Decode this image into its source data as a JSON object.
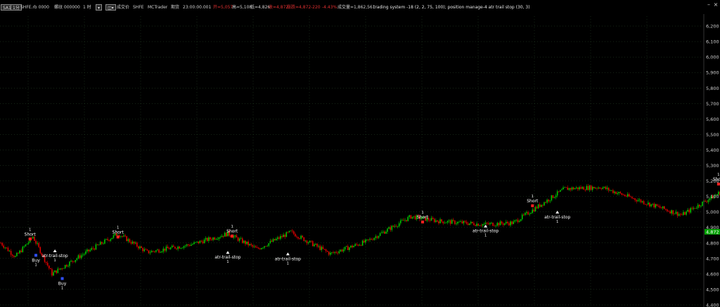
{
  "header": {
    "symbol_button": "SA1",
    "interval_button": "1分",
    "symbol": "SHFE.rb 0000",
    "name": "螺纹 000000",
    "period": "1 时",
    "menu_button_1": "▾",
    "menu_button_2": "◫▾",
    "volume_label": "成交价",
    "exchange": "SHFE",
    "source": "MCTrader",
    "range_label": "期货",
    "time": "23:00:00.001",
    "open": "开=5,057",
    "high": "高=5,108",
    "low": "低=4,826",
    "close": "收=4,872",
    "change": "涨跌=4,872",
    "delta": "-220",
    "pct": "-4.43%",
    "turnover": "成交量=1,862,561",
    "strategy": "trading system -18 (2, 2, 75, 100); position manage-4 atr trail stop (30, 3)",
    "price_tag": "4,872",
    "colors": {
      "up": "#00c800",
      "down": "#e00000",
      "grid": "#2b4a2b",
      "axis_text": "#cfcfcf",
      "tag_bg": "#00a000"
    }
  },
  "chart_data": {
    "type": "candlestick",
    "y_axis_side": "right",
    "ylim": [
      4400,
      6300
    ],
    "yticks": [
      4400,
      4500,
      4600,
      4700,
      4800,
      4900,
      5000,
      5100,
      5200,
      5300,
      5400,
      5500,
      5600,
      5700,
      5800,
      5900,
      6000,
      6100,
      6200
    ],
    "ytick_labels": [
      "4,400",
      "4,500",
      "4,600",
      "4,700",
      "4,800",
      "4,900",
      "5,000",
      "5,100",
      "5,200",
      "5,300",
      "5,400",
      "5,500",
      "5,600",
      "5,700",
      "5,800",
      "5,900",
      "6,000",
      "6,100",
      "6,200"
    ],
    "grid": true,
    "bar_count": 480,
    "path": [
      [
        0,
        4800
      ],
      [
        10,
        4710
      ],
      [
        22,
        4840
      ],
      [
        35,
        4600
      ],
      [
        55,
        4720
      ],
      [
        80,
        4860
      ],
      [
        100,
        4740
      ],
      [
        130,
        4790
      ],
      [
        155,
        4860
      ],
      [
        175,
        4760
      ],
      [
        198,
        4870
      ],
      [
        225,
        4730
      ],
      [
        250,
        4810
      ],
      [
        280,
        4970
      ],
      [
        300,
        4940
      ],
      [
        330,
        4920
      ],
      [
        350,
        4930
      ],
      [
        385,
        5150
      ],
      [
        410,
        5160
      ],
      [
        440,
        5060
      ],
      [
        465,
        4980
      ],
      [
        490,
        5120
      ],
      [
        520,
        5140
      ],
      [
        560,
        5110
      ],
      [
        590,
        5100
      ],
      [
        610,
        5200
      ],
      [
        640,
        5290
      ],
      [
        670,
        5350
      ],
      [
        700,
        5360
      ],
      [
        730,
        5510
      ],
      [
        760,
        5630
      ],
      [
        775,
        5950
      ],
      [
        795,
        6050
      ],
      [
        815,
        6130
      ],
      [
        830,
        6030
      ],
      [
        845,
        5720
      ],
      [
        860,
        5590
      ],
      [
        875,
        5580
      ],
      [
        895,
        5540
      ],
      [
        910,
        5440
      ],
      [
        925,
        5050
      ],
      [
        945,
        5200
      ],
      [
        960,
        4900
      ],
      [
        961,
        4860
      ]
    ],
    "signals": [
      {
        "label": "Short",
        "qty": "1",
        "x": 20,
        "price": 4825,
        "kind": "short"
      },
      {
        "label": "atr-trail-stop",
        "qty": "1",
        "x": 37,
        "price": 4740,
        "kind": "stop"
      },
      {
        "label": "Buy",
        "qty": "1",
        "x": 24,
        "price": 4720,
        "kind": "buy"
      },
      {
        "label": "Buy",
        "qty": "1",
        "x": 42,
        "price": 4570,
        "kind": "buy"
      },
      {
        "label": "Short",
        "qty": "1",
        "x": 80,
        "price": 4838,
        "kind": "short"
      },
      {
        "label": "Short",
        "qty": "1",
        "x": 158,
        "price": 4845,
        "kind": "short"
      },
      {
        "label": "atr-trail-stop",
        "qty": "1",
        "x": 155,
        "price": 4730,
        "kind": "stop"
      },
      {
        "label": "atr-trail-stop",
        "qty": "1",
        "x": 196,
        "price": 4720,
        "kind": "stop"
      },
      {
        "label": "Short",
        "qty": "1",
        "x": 288,
        "price": 4935,
        "kind": "short"
      },
      {
        "label": "atr-trail-stop",
        "qty": "1",
        "x": 331,
        "price": 4900,
        "kind": "stop"
      },
      {
        "label": "Short",
        "qty": "1",
        "x": 363,
        "price": 5040,
        "kind": "short"
      },
      {
        "label": "atr-trail-stop",
        "qty": "1",
        "x": 380,
        "price": 4990,
        "kind": "stop"
      },
      {
        "label": "Short",
        "qty": "1",
        "x": 490,
        "price": 5180,
        "kind": "short"
      },
      {
        "label": "Short",
        "qty": "1",
        "x": 585,
        "price": 5190,
        "kind": "short"
      },
      {
        "label": "atr-trail-stop",
        "qty": "1",
        "x": 581,
        "price": 5070,
        "kind": "stop"
      },
      {
        "label": "atr-trail-stop",
        "qty": "1",
        "x": 605,
        "price": 5120,
        "kind": "stop"
      },
      {
        "label": "Short",
        "qty": "1",
        "x": 641,
        "price": 5330,
        "kind": "short"
      },
      {
        "label": "atr-trail-stop",
        "qty": "1",
        "x": 645,
        "price": 5300,
        "kind": "stop"
      },
      {
        "label": "Buy",
        "qty": "1",
        "x": 682,
        "price": 5300,
        "kind": "buy"
      },
      {
        "label": "Short",
        "qty": "1",
        "x": 720,
        "price": 5490,
        "kind": "short"
      },
      {
        "label": "atr-trail-stop",
        "qty": "1",
        "x": 737,
        "price": 5460,
        "kind": "stop"
      },
      {
        "label": "Short",
        "qty": "1",
        "x": 738,
        "price": 5630,
        "kind": "short"
      },
      {
        "label": "atr-trail-stop",
        "qty": "1",
        "x": 769,
        "price": 5590,
        "kind": "stop"
      },
      {
        "label": "Short",
        "qty": "1",
        "x": 824,
        "price": 6170,
        "kind": "short"
      },
      {
        "label": "Buy",
        "qty": "1",
        "x": 866,
        "price": 5530,
        "kind": "buy"
      },
      {
        "label": "atr-trail-stop",
        "qty": "1",
        "x": 909,
        "price": 5510,
        "kind": "stop"
      },
      {
        "label": "Buy",
        "qty": "1",
        "x": 960,
        "price": 4840,
        "kind": "buy"
      }
    ]
  }
}
